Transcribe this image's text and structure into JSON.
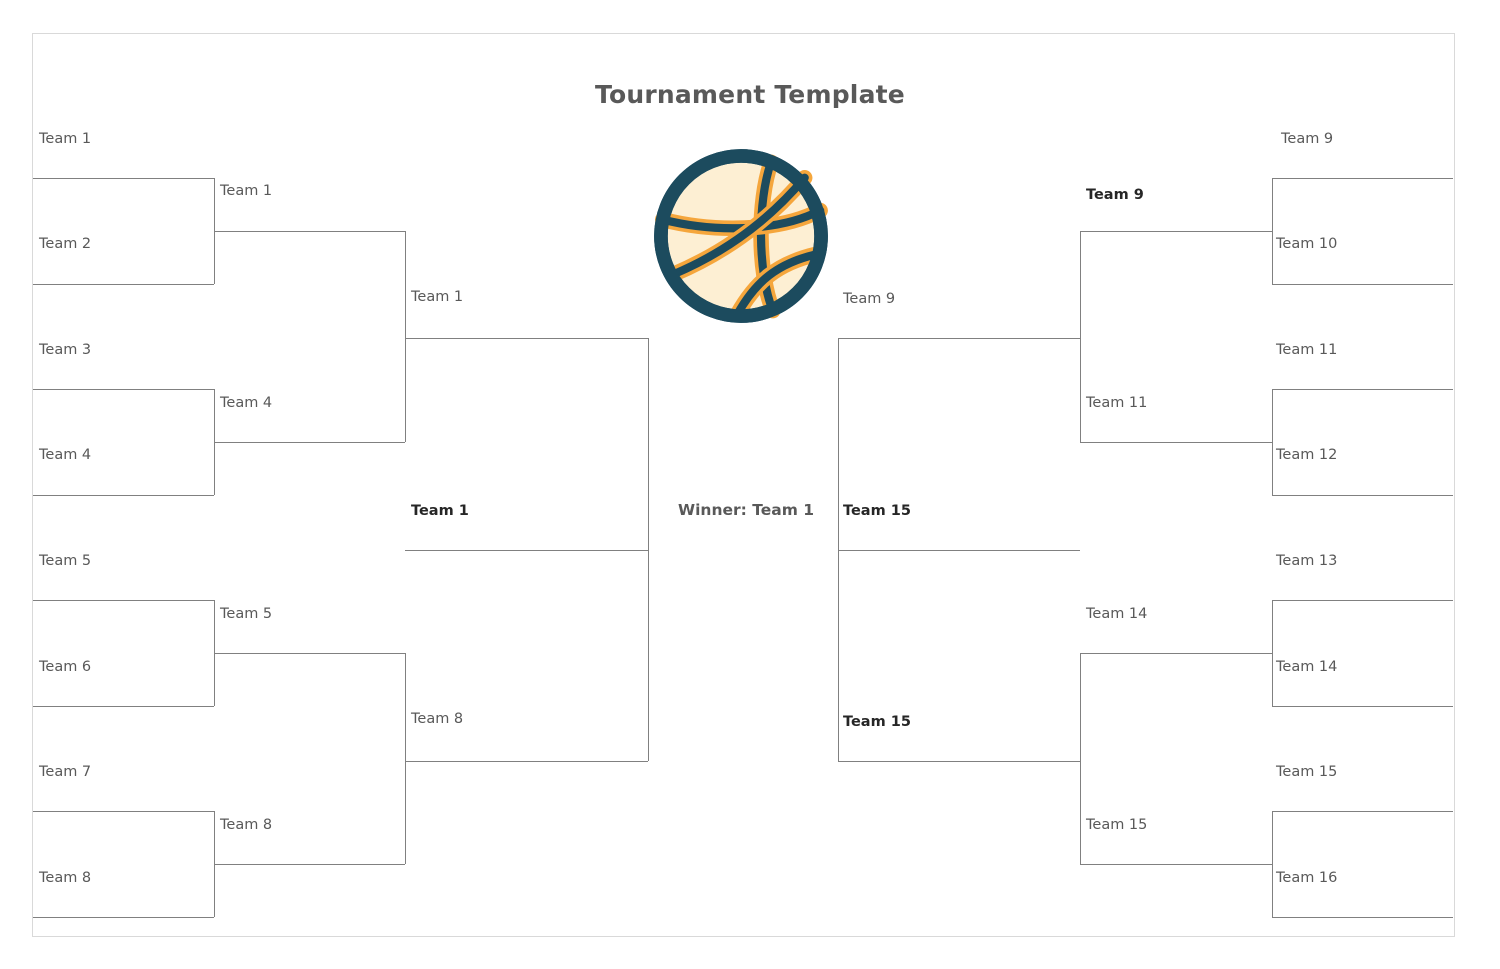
{
  "page": {
    "title": "Tournament Template",
    "winner_label": "Winner: Team 1",
    "colors": {
      "border": "#d9d9d9",
      "bracket_line": "#808080",
      "label_text": "#595959",
      "label_text_bold": "#262626",
      "ball_fill": "#fdefd3",
      "ball_orange": "#f5a63c",
      "ball_teal": "#1c4b5e"
    }
  },
  "icon": {
    "name": "basketball-icon"
  },
  "left": {
    "round1": [
      {
        "label": "Team 1"
      },
      {
        "label": "Team 2"
      },
      {
        "label": "Team 3"
      },
      {
        "label": "Team 4"
      },
      {
        "label": "Team 5"
      },
      {
        "label": "Team 6"
      },
      {
        "label": "Team 7"
      },
      {
        "label": "Team 8"
      }
    ],
    "round2": [
      {
        "label": "Team 1"
      },
      {
        "label": "Team 4"
      },
      {
        "label": "Team 5"
      },
      {
        "label": "Team 8"
      }
    ],
    "round3": [
      {
        "label": "Team 1"
      },
      {
        "label": "Team 8"
      }
    ],
    "round4": [
      {
        "label": "Team 1"
      }
    ]
  },
  "right": {
    "round1": [
      {
        "label": "Team 9"
      },
      {
        "label": "Team 10"
      },
      {
        "label": "Team 11"
      },
      {
        "label": "Team 12"
      },
      {
        "label": "Team 13"
      },
      {
        "label": "Team 14"
      },
      {
        "label": "Team 15"
      },
      {
        "label": "Team 16"
      }
    ],
    "round2": [
      {
        "label": "Team 9"
      },
      {
        "label": "Team 11"
      },
      {
        "label": "Team 14"
      },
      {
        "label": "Team 15"
      }
    ],
    "round3": [
      {
        "label": "Team 9"
      },
      {
        "label": "Team 15"
      }
    ],
    "round4": [
      {
        "label": "Team 15"
      }
    ]
  }
}
